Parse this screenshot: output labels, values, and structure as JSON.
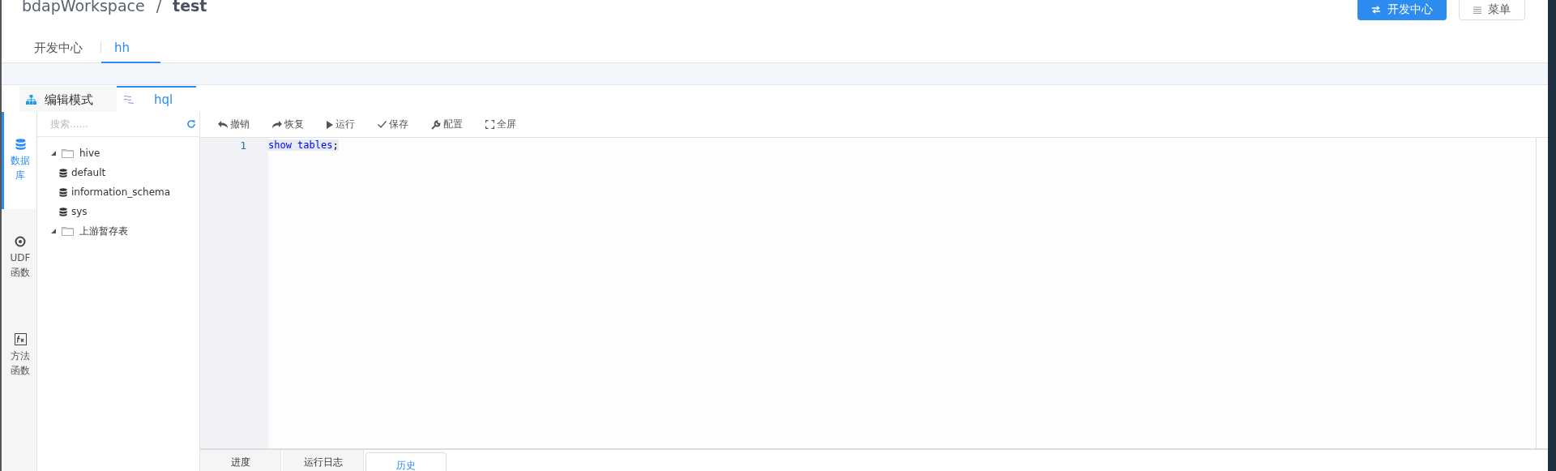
{
  "header": {
    "breadcrumb": [
      "bdapWorkspace",
      "/",
      "test"
    ],
    "buttons": [
      {
        "label": "开发中心",
        "kind": "primary"
      },
      {
        "label": "菜单",
        "kind": "default"
      }
    ]
  },
  "tabs": [
    {
      "label": "开发中心",
      "selected": false
    },
    {
      "label": "hh",
      "selected": true
    }
  ],
  "editor_tabs": [
    {
      "label": "编辑模式",
      "kind": "mode",
      "selected": false
    },
    {
      "label": "hql",
      "kind": "script",
      "selected": true
    }
  ],
  "rail": [
    {
      "label": "数据库",
      "kind": "database",
      "selected": true
    },
    {
      "label": "UDF函数",
      "kind": "udf",
      "selected": false
    },
    {
      "label": "方法函数",
      "kind": "function",
      "selected": false
    }
  ],
  "search": {
    "placeholder": "搜索......"
  },
  "tree": [
    {
      "label": "hive",
      "kind": "folder",
      "expanded": true,
      "children": [
        {
          "label": "default",
          "kind": "db"
        },
        {
          "label": "information_schema",
          "kind": "db"
        },
        {
          "label": "sys",
          "kind": "db"
        }
      ]
    },
    {
      "label": "上游暂存表",
      "kind": "folder",
      "expanded": true
    }
  ],
  "toolbar": [
    {
      "label": "撤销",
      "kind": "undo"
    },
    {
      "label": "恢复",
      "kind": "redo"
    },
    {
      "label": "运行",
      "kind": "run"
    },
    {
      "label": "保存",
      "kind": "save"
    },
    {
      "label": "配置",
      "kind": "config"
    },
    {
      "label": "全屏",
      "kind": "fullscreen"
    }
  ],
  "code_lines": [
    {
      "number": "1",
      "tokens": [
        {
          "text": "show tables",
          "kind": "keyword"
        },
        {
          "text": ";",
          "kind": "plain"
        }
      ]
    }
  ],
  "bottom_tabs": [
    {
      "label": "进度",
      "selected": false
    },
    {
      "label": "运行日志",
      "selected": false
    },
    {
      "label": "历史",
      "selected": true
    }
  ]
}
